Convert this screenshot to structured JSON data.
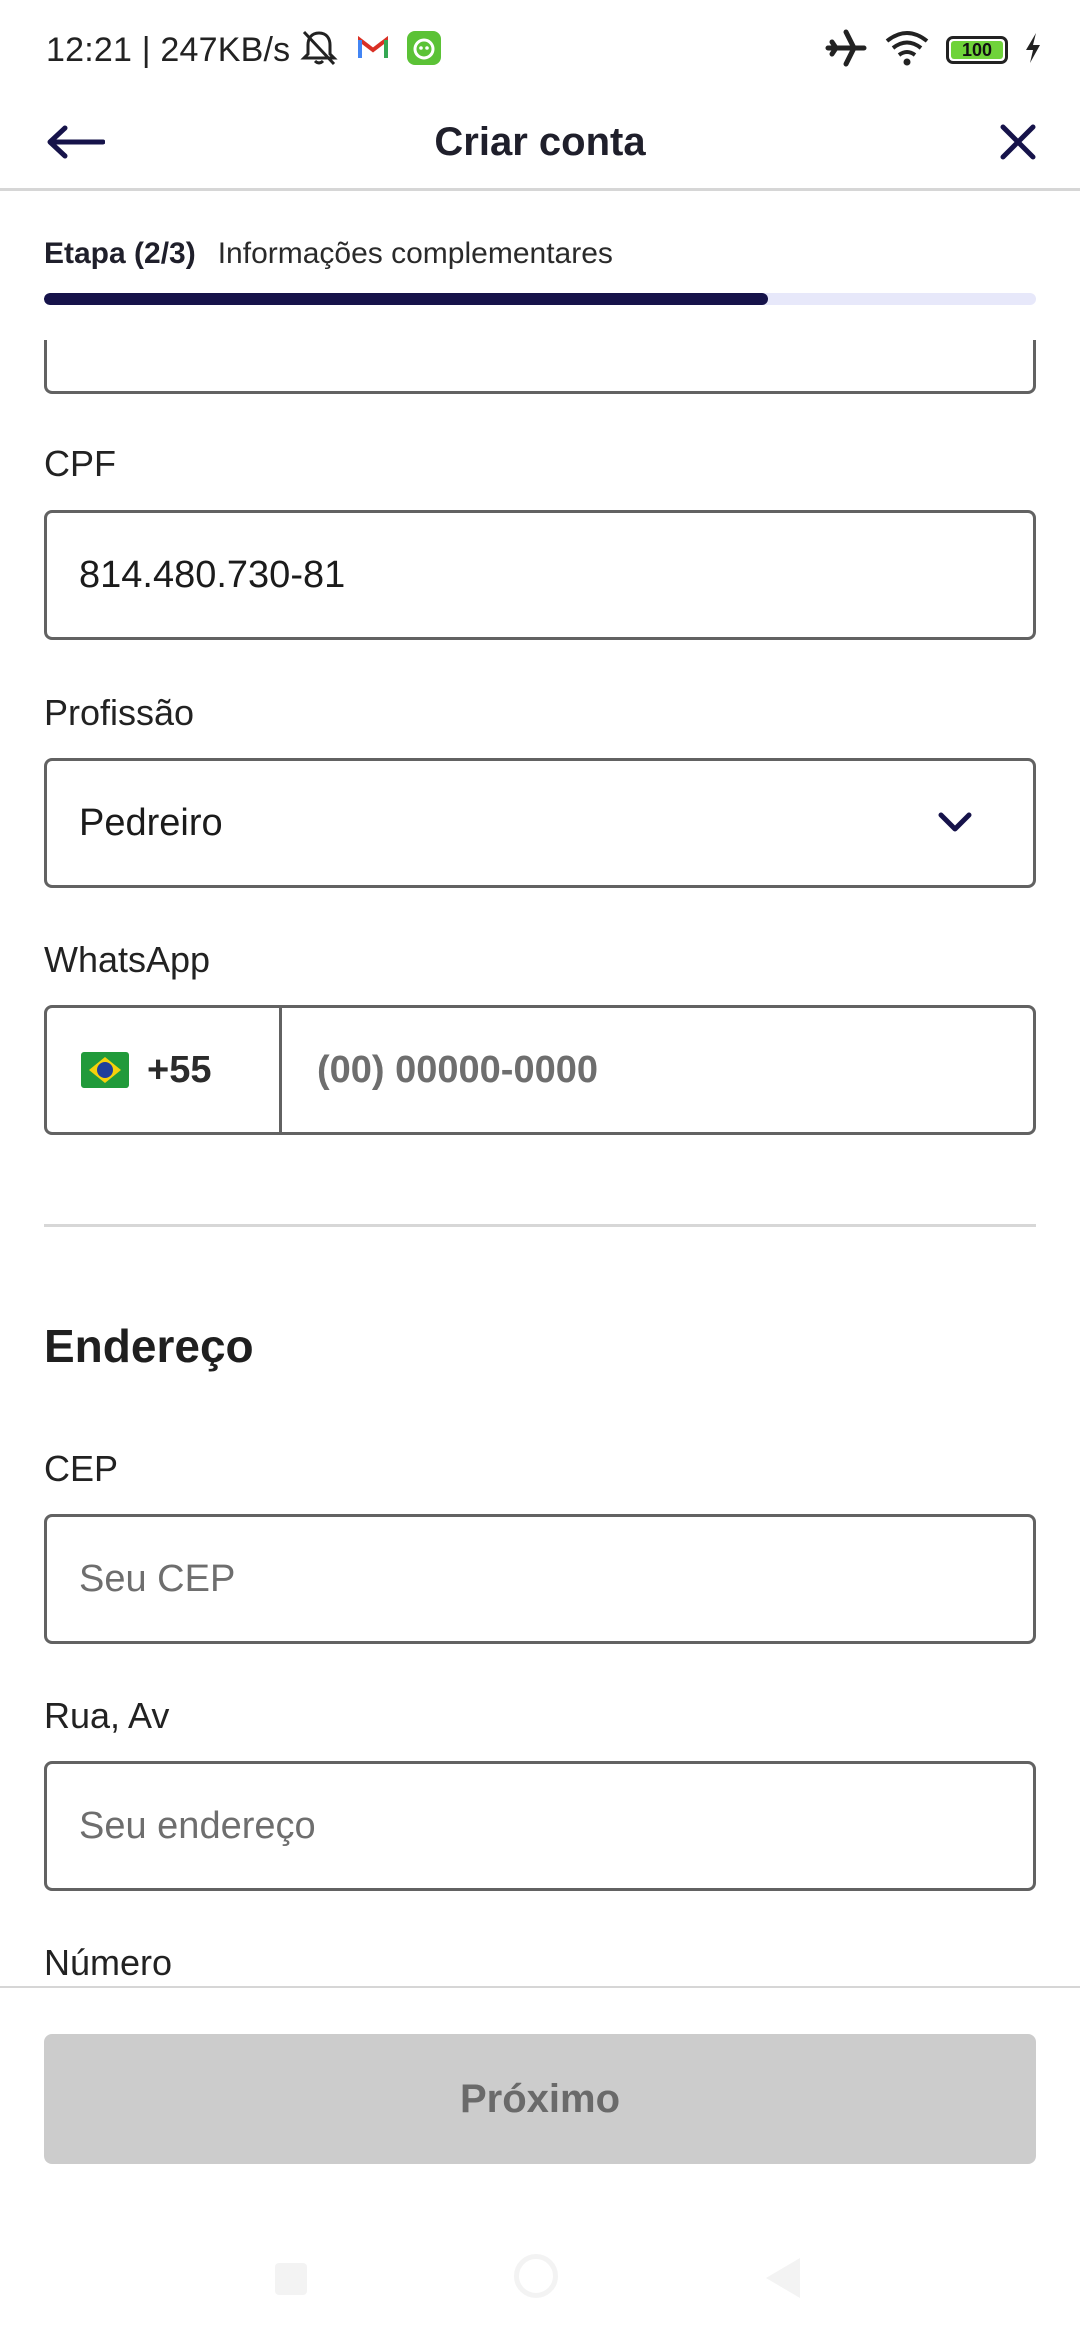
{
  "status_bar": {
    "time": "12:21 | 247KB/s",
    "battery": "100",
    "icons": [
      "mute-bell-icon",
      "gmail-icon",
      "app-icon",
      "airplane-icon",
      "wifi-icon",
      "battery-icon",
      "charging-icon"
    ]
  },
  "header": {
    "title": "Criar conta",
    "back_icon": "arrow-left-icon",
    "close_icon": "close-icon"
  },
  "step": {
    "label": "Etapa (2/3)",
    "description": "Informações complementares",
    "progress_fraction": 0.73
  },
  "form": {
    "cpf": {
      "label": "CPF",
      "value": "814.480.730-81"
    },
    "profissao": {
      "label": "Profissão",
      "value": "Pedreiro"
    },
    "whatsapp": {
      "label": "WhatsApp",
      "country_code": "+55",
      "placeholder": "(00) 00000-0000"
    }
  },
  "address": {
    "section_title": "Endereço",
    "cep": {
      "label": "CEP",
      "placeholder": "Seu CEP"
    },
    "rua": {
      "label": "Rua, Av",
      "placeholder": "Seu endereço"
    },
    "numero": {
      "label": "Número"
    }
  },
  "footer": {
    "next_label": "Próximo"
  },
  "colors": {
    "primary": "#16134a",
    "progress_track": "#e7e8fa",
    "disabled_button": "#cccccc"
  }
}
